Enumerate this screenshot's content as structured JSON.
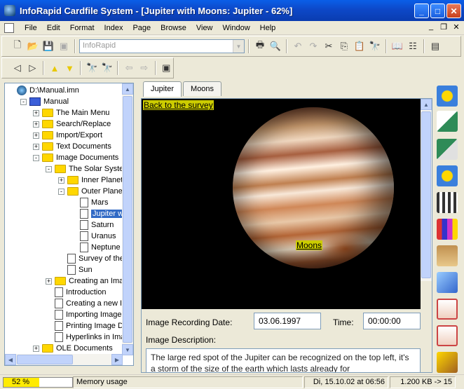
{
  "window": {
    "title": "InfoRapid Cardfile System - [Jupiter with Moons: Jupiter - 62%]"
  },
  "menu": [
    "File",
    "Edit",
    "Format",
    "Index",
    "Page",
    "Browse",
    "View",
    "Window",
    "Help"
  ],
  "toolbar": {
    "combo_value": "InfoRapid"
  },
  "tree": {
    "rows": [
      {
        "label": "D:\\Manual.imn",
        "icon": "disk",
        "exp": "",
        "indent": 0
      },
      {
        "label": "Manual",
        "icon": "book",
        "exp": "-",
        "indent": 1
      },
      {
        "label": "The Main Menu",
        "icon": "folder",
        "exp": "+",
        "indent": 2
      },
      {
        "label": "Search/Replace",
        "icon": "folder",
        "exp": "+",
        "indent": 2
      },
      {
        "label": "Import/Export",
        "icon": "folder",
        "exp": "+",
        "indent": 2
      },
      {
        "label": "Text Documents",
        "icon": "folder",
        "exp": "+",
        "indent": 2
      },
      {
        "label": "Image Documents",
        "icon": "folder",
        "exp": "-",
        "indent": 2
      },
      {
        "label": "The Solar System",
        "icon": "folder",
        "exp": "-",
        "indent": 3
      },
      {
        "label": "Inner Planets",
        "icon": "folder",
        "exp": "+",
        "indent": 4
      },
      {
        "label": "Outer Planets",
        "icon": "folder",
        "exp": "-",
        "indent": 4
      },
      {
        "label": "Mars",
        "icon": "doc",
        "exp": "",
        "indent": 5
      },
      {
        "label": "Jupiter wi",
        "icon": "doc",
        "exp": "",
        "indent": 5,
        "selected": true
      },
      {
        "label": "Saturn",
        "icon": "doc",
        "exp": "",
        "indent": 5
      },
      {
        "label": "Uranus",
        "icon": "doc",
        "exp": "",
        "indent": 5
      },
      {
        "label": "Neptune",
        "icon": "doc",
        "exp": "",
        "indent": 5
      },
      {
        "label": "Survey of the",
        "icon": "doc",
        "exp": "",
        "indent": 4
      },
      {
        "label": "Sun",
        "icon": "doc",
        "exp": "",
        "indent": 4
      },
      {
        "label": "Creating an Imag",
        "icon": "folder",
        "exp": "+",
        "indent": 3
      },
      {
        "label": "Introduction",
        "icon": "doc",
        "exp": "",
        "indent": 3
      },
      {
        "label": "Creating a new Ir",
        "icon": "doc",
        "exp": "",
        "indent": 3
      },
      {
        "label": "Importing Image I",
        "icon": "doc",
        "exp": "",
        "indent": 3
      },
      {
        "label": "Printing Image Do",
        "icon": "doc",
        "exp": "",
        "indent": 3
      },
      {
        "label": "Hyperlinks in Imag",
        "icon": "doc",
        "exp": "",
        "indent": 3
      },
      {
        "label": "OLE Documents",
        "icon": "folder",
        "exp": "+",
        "indent": 2
      }
    ]
  },
  "tabs": [
    "Jupiter",
    "Moons"
  ],
  "image": {
    "back_link": "Back to the survey",
    "moons_link": "Moons"
  },
  "fields": {
    "date_label": "Image Recording Date:",
    "date_value": "03.06.1997",
    "time_label": "Time:",
    "time_value": "00:00:00",
    "desc_label": "Image Description:",
    "desc_text": "The large red spot of the Jupiter can be recognized on the top left, it's a storm of the size of the earth which lasts already for"
  },
  "status": {
    "progress_text": "52 %",
    "progress": 0.52,
    "memory_label": "Memory usage",
    "datetime": "Di, 15.10.02 at 06:56",
    "size": "1.200 KB -> 15"
  },
  "colors": {
    "accent": "#316ac5",
    "link_bg": "#cccc00",
    "progress": "#ffeb00"
  }
}
